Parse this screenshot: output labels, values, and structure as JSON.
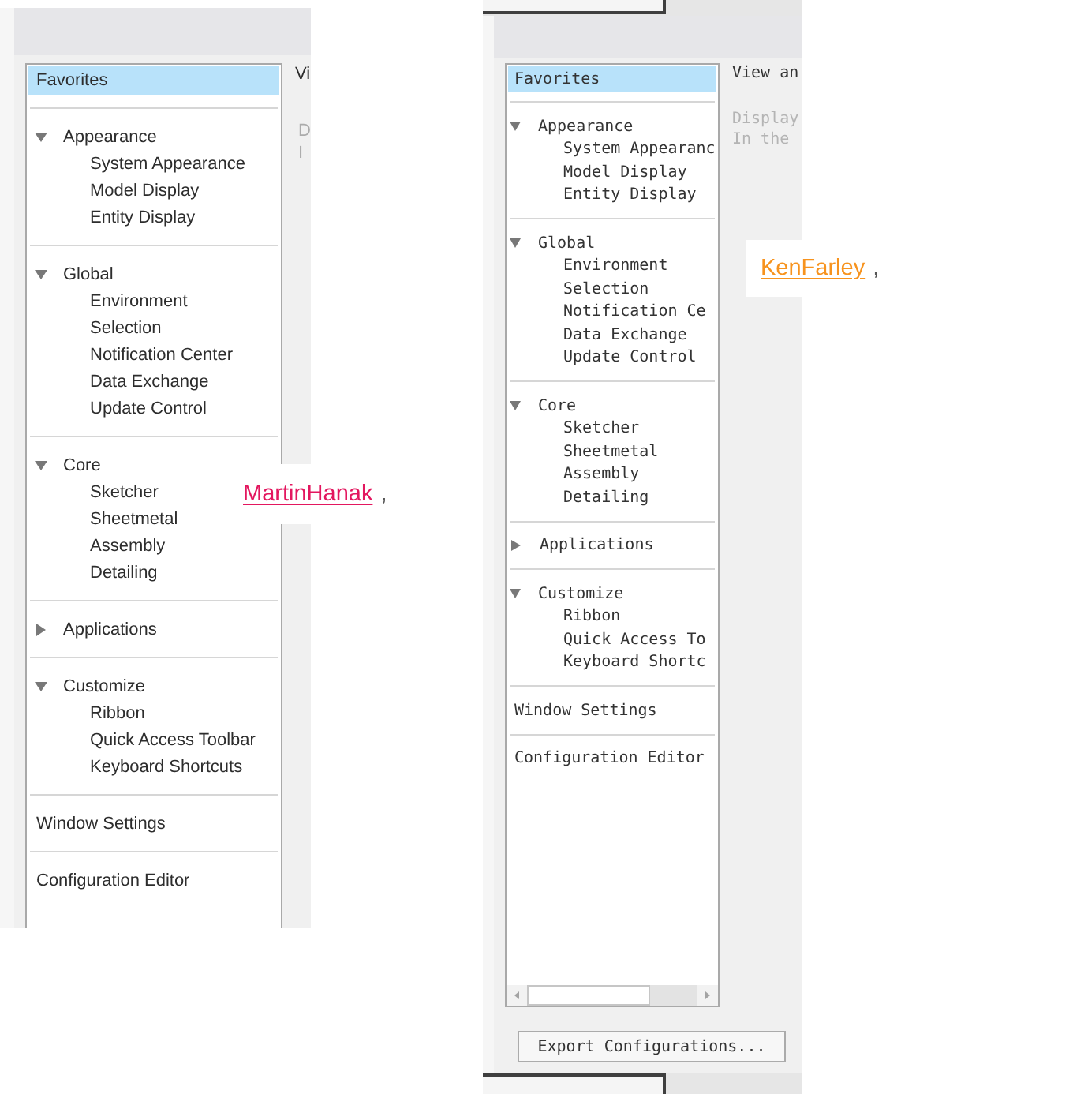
{
  "panels": [
    {
      "kind": "proportional",
      "sidebar": {
        "items": [
          {
            "label": "Favorites",
            "selected": true
          },
          {
            "label": "Appearance",
            "selected": false,
            "expanded": true,
            "children": [
              {
                "label": "System Appearance",
                "selected": false
              },
              {
                "label": "Model Display",
                "selected": false
              },
              {
                "label": "Entity Display",
                "selected": false
              }
            ]
          },
          {
            "label": "Global",
            "selected": false,
            "expanded": true,
            "children": [
              {
                "label": "Environment",
                "selected": false
              },
              {
                "label": "Selection",
                "selected": false
              },
              {
                "label": "Notification Center",
                "selected": false
              },
              {
                "label": "Data Exchange",
                "selected": false
              },
              {
                "label": "Update Control",
                "selected": false
              }
            ]
          },
          {
            "label": "Core",
            "selected": false,
            "expanded": true,
            "children": [
              {
                "label": "Sketcher",
                "selected": false
              },
              {
                "label": "Sheetmetal",
                "selected": false
              },
              {
                "label": "Assembly",
                "selected": false
              },
              {
                "label": "Detailing",
                "selected": false
              }
            ]
          },
          {
            "label": "Applications",
            "selected": false,
            "expanded": false
          },
          {
            "label": "Customize",
            "selected": false,
            "expanded": true,
            "children": [
              {
                "label": "Ribbon",
                "selected": false
              },
              {
                "label": "Quick Access Toolbar",
                "selected": false
              },
              {
                "label": "Keyboard Shortcuts",
                "selected": false
              }
            ]
          },
          {
            "label": "Window Settings",
            "selected": false
          },
          {
            "label": "Configuration Editor",
            "selected": false
          }
        ]
      },
      "content": {
        "heading": "Vi",
        "description": [
          "D",
          "I"
        ]
      },
      "mention": {
        "user": "MartinHanak",
        "suffix": ",",
        "color": "#e3175f"
      }
    },
    {
      "kind": "monospace",
      "sidebar": {
        "items": [
          {
            "label": "Favorites",
            "selected": true
          },
          {
            "label": "Appearance",
            "selected": false,
            "expanded": true,
            "children": [
              {
                "label": "System Appearanc",
                "selected": false
              },
              {
                "label": "Model Display",
                "selected": false
              },
              {
                "label": "Entity Display",
                "selected": false
              }
            ]
          },
          {
            "label": "Global",
            "selected": false,
            "expanded": true,
            "children": [
              {
                "label": "Environment",
                "selected": false
              },
              {
                "label": "Selection",
                "selected": false
              },
              {
                "label": "Notification Ce",
                "selected": false
              },
              {
                "label": "Data Exchange",
                "selected": false
              },
              {
                "label": "Update Control",
                "selected": false
              }
            ]
          },
          {
            "label": "Core",
            "selected": false,
            "expanded": true,
            "children": [
              {
                "label": "Sketcher",
                "selected": false
              },
              {
                "label": "Sheetmetal",
                "selected": false
              },
              {
                "label": "Assembly",
                "selected": false
              },
              {
                "label": "Detailing",
                "selected": false
              }
            ]
          },
          {
            "label": "Applications",
            "selected": false,
            "expanded": false
          },
          {
            "label": "Customize",
            "selected": false,
            "expanded": true,
            "children": [
              {
                "label": "Ribbon",
                "selected": false
              },
              {
                "label": "Quick Access To",
                "selected": false
              },
              {
                "label": "Keyboard Shortc",
                "selected": false
              }
            ]
          },
          {
            "label": "Window Settings",
            "selected": false
          },
          {
            "label": "Configuration Editor",
            "selected": false
          }
        ]
      },
      "content": {
        "heading": "View an",
        "description": [
          "Display",
          "In the"
        ]
      },
      "buttons": [
        "Export Configurations..."
      ],
      "mention": {
        "user": "KenFarley",
        "suffix": ",",
        "color": "#f7931e"
      }
    }
  ]
}
